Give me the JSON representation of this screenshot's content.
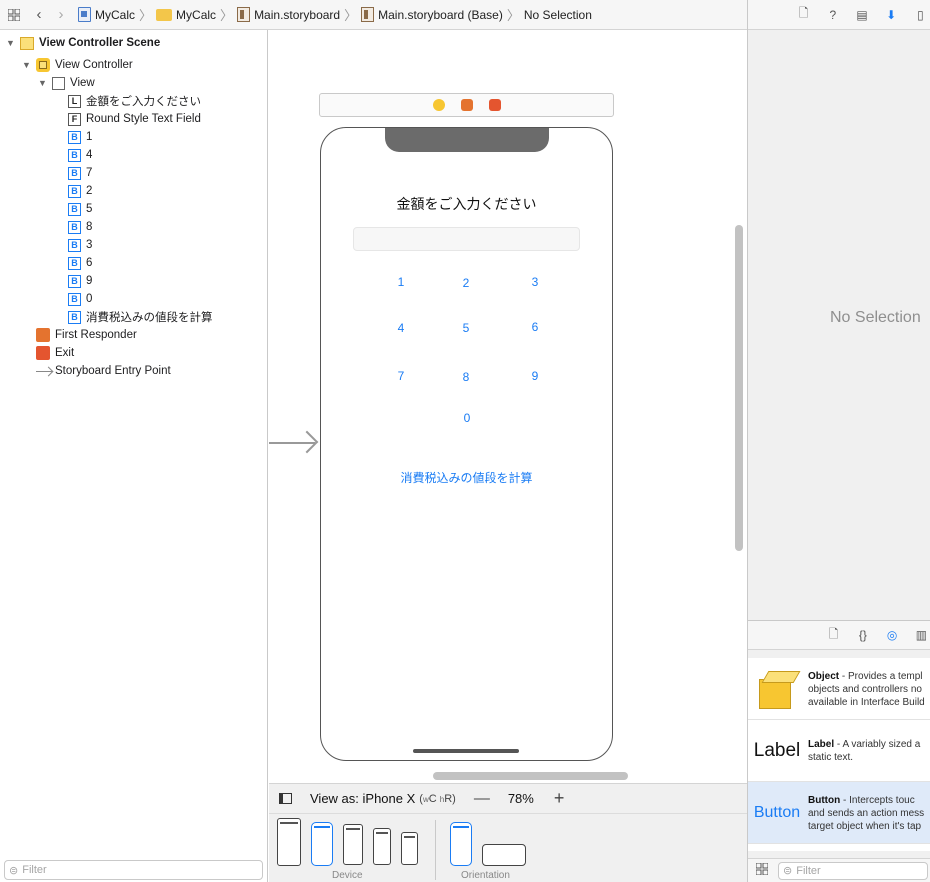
{
  "jumpbar": {
    "crumbs": [
      "MyCalc",
      "MyCalc",
      "Main.storyboard",
      "Main.storyboard (Base)",
      "No Selection"
    ]
  },
  "outline": {
    "scene": "View Controller Scene",
    "view_controller": "View Controller",
    "view": "View",
    "children": [
      {
        "badge": "L",
        "label": "金額をご入力ください"
      },
      {
        "badge": "F",
        "label": "Round Style Text Field"
      },
      {
        "badge": "B",
        "label": "1"
      },
      {
        "badge": "B",
        "label": "4"
      },
      {
        "badge": "B",
        "label": "7"
      },
      {
        "badge": "B",
        "label": "2"
      },
      {
        "badge": "B",
        "label": "5"
      },
      {
        "badge": "B",
        "label": "8"
      },
      {
        "badge": "B",
        "label": "3"
      },
      {
        "badge": "B",
        "label": "6"
      },
      {
        "badge": "B",
        "label": "9"
      },
      {
        "badge": "B",
        "label": "0"
      },
      {
        "badge": "B",
        "label": "消費税込みの値段を計算"
      }
    ],
    "first_responder": "First Responder",
    "exit": "Exit",
    "entry_point": "Storyboard Entry Point",
    "filter_placeholder": "Filter"
  },
  "phone": {
    "title": "金額をご入力ください",
    "keys": [
      "1",
      "2",
      "3",
      "4",
      "5",
      "6",
      "7",
      "8",
      "9",
      "0"
    ],
    "calc_button": "消費税込みの値段を計算"
  },
  "viewas": {
    "label": "View as: iPhone X",
    "size_class_w": "w",
    "size_class_w_val": "C",
    "size_class_h": "h",
    "size_class_h_val": "R",
    "zoom": "78%"
  },
  "devices": {
    "device_label": "Device",
    "orientation_label": "Orientation"
  },
  "inspector": {
    "no_selection": "No Selection"
  },
  "library": {
    "items": [
      {
        "title": "Object",
        "desc1": " - Provides a templ",
        "desc2": "objects and controllers no",
        "desc3": "available in Interface Build",
        "thumb": ""
      },
      {
        "title": "Label",
        "desc1": " - A variably sized a",
        "desc2": "static text.",
        "desc3": "",
        "thumb": "Label"
      },
      {
        "title": "Button",
        "desc1": " - Intercepts touc",
        "desc2": "and sends an action mess",
        "desc3": "target object when it's tap",
        "thumb": "Button"
      }
    ],
    "filter_placeholder": "Filter"
  },
  "colors": {
    "accent": "#1a7cf4",
    "scene_yellow": "#f7c631",
    "responder_orange": "#e4732f",
    "exit_red": "#e4552f"
  }
}
